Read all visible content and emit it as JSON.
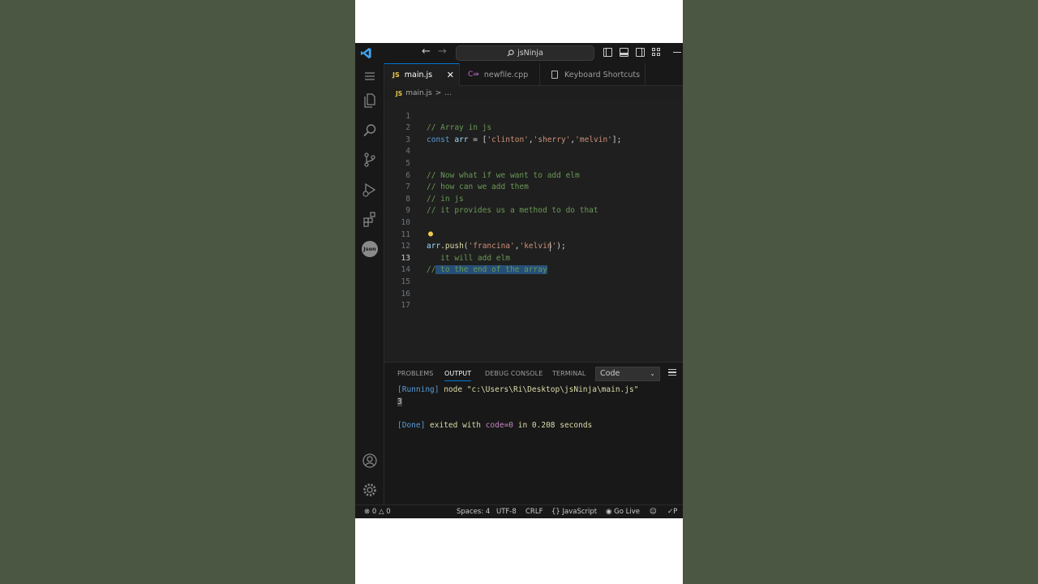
{
  "titlebar": {
    "search_text": "jsNinja",
    "icons": [
      "vscode-logo-icon",
      "arrow-left-icon",
      "arrow-right-icon",
      "search-icon",
      "toggle-sidebar-icon",
      "toggle-panel-icon",
      "toggle-secondary-sidebar-icon",
      "customize-layout-icon",
      "minimize-icon"
    ]
  },
  "activity_bar": {
    "icons": [
      "menu-icon",
      "explorer-icon",
      "search-icon",
      "source-control-icon",
      "run-debug-icon",
      "extensions-icon",
      "json-icon",
      "account-icon",
      "settings-gear-icon"
    ],
    "json_label": "Json"
  },
  "tabs": [
    {
      "badge": "JS",
      "label": "main.js",
      "active": true
    },
    {
      "badge": "C++",
      "label": "newfile.cpp",
      "active": false
    },
    {
      "badge": "",
      "label": "Keyboard Shortcuts",
      "active": false
    }
  ],
  "breadcrumb": {
    "badge": "JS",
    "file": "main.js",
    "separator": ">",
    "more": "..."
  },
  "editor": {
    "line_numbers": [
      "1",
      "2",
      "3",
      "4",
      "5",
      "6",
      "7",
      "8",
      "9",
      "10",
      "11",
      "12",
      "13",
      "14",
      "15",
      "16",
      "17"
    ],
    "current_line": "13",
    "code": {
      "l1": "// Array in js",
      "l2_kw": "const",
      "l2_var": "arr",
      "l2_eq": " = [",
      "l2_s1": "'clinton'",
      "l2_s2": "'sherry'",
      "l2_s3": "'melvin'",
      "l2_end": "];",
      "l5": "// Now what if we want to add elm",
      "l6": "// how can we add them",
      "l7": "// in js",
      "l8": "// it provides us a method to do that",
      "l11_var": "arr",
      "l11_fn": "push",
      "l11_s1": "'francina'",
      "l11_s2": "'kelvin'",
      "l11_end": ");",
      "l12": " it will add elm",
      "l13_pre": "//",
      "l13_sel": " to the end of the array"
    }
  },
  "panel": {
    "tabs": [
      "PROBLEMS",
      "OUTPUT",
      "DEBUG CONSOLE",
      "TERMINAL"
    ],
    "active_tab": "OUTPUT",
    "select_value": "Code",
    "output": {
      "running_tag": "[Running]",
      "running_cmd": " node \"c:\\Users\\Ri\\Desktop\\jsNinja\\main.js\"",
      "result": "3",
      "done_tag": "[Done]",
      "done_text1": " exited with ",
      "done_code": "code=0",
      "done_text2": " in ",
      "done_time": "0.208",
      "done_text3": " seconds"
    }
  },
  "statusbar": {
    "errors": "0",
    "warnings": "0",
    "spaces": "Spaces: 4",
    "encoding": "UTF-8",
    "eol": "CRLF",
    "language": "JavaScript",
    "golive": "Go Live",
    "prettier": "P"
  },
  "colors": {
    "background": "#4b5643",
    "editor_bg": "#1f1f1f",
    "accent": "#0078d4",
    "selection": "#264f78",
    "comment": "#6a9955",
    "string": "#ce9178",
    "keyword": "#569cd6"
  }
}
